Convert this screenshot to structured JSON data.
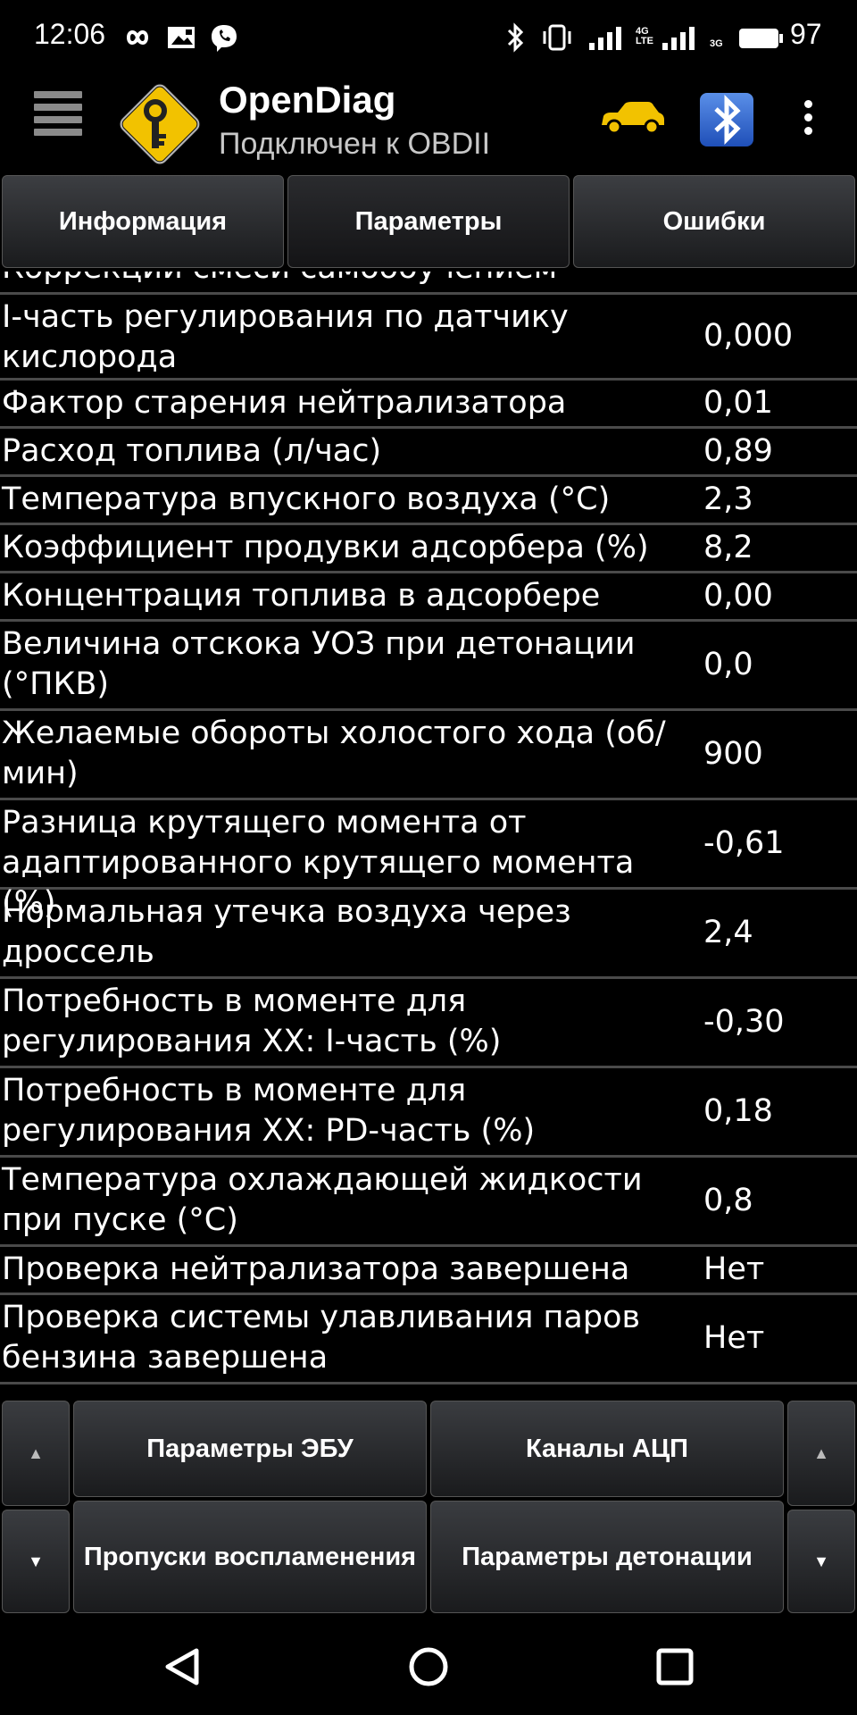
{
  "status_bar": {
    "time": "12:06",
    "net_4g_top": "4G",
    "net_4g_bottom": "LTE",
    "net_3g": "3G",
    "battery": "97"
  },
  "app_bar": {
    "title": "OpenDiag",
    "subtitle": "Подключен к OBDII"
  },
  "tabs": [
    {
      "label": "Информация"
    },
    {
      "label": "Параметры"
    },
    {
      "label": "Ошибки"
    }
  ],
  "params": {
    "partial_top": "Коррекции смеси самообучением",
    "rows": [
      {
        "name": "I-часть регулирования по датчику кислорода",
        "value": "0,000"
      },
      {
        "name": "Фактор старения нейтрализатора",
        "value": "0,01"
      },
      {
        "name": "Расход топлива (л/час)",
        "value": "0,89"
      },
      {
        "name": "Температура впускного воздуха (°С)",
        "value": "2,3"
      },
      {
        "name": "Коэффициент продувки адсорбера (%)",
        "value": "8,2"
      },
      {
        "name": "Концентрация топлива в адсорбере",
        "value": "0,00"
      },
      {
        "name": "Величина отскока УОЗ при детонации (°ПКВ)",
        "value": "0,0"
      },
      {
        "name": "Желаемые обороты холостого хода (об/мин)",
        "value": "900"
      },
      {
        "name": "Разница крутящего момента от адаптированного крутящего момента (%)",
        "value": "-0,61"
      },
      {
        "name": "Нормальная утечка воздуха через дроссель",
        "value": "2,4"
      },
      {
        "name": "Потребность в моменте для регулирования ХХ: I-часть (%)",
        "value": "-0,30"
      },
      {
        "name": "Потребность в моменте для регулирования ХХ: PD-часть (%)",
        "value": "0,18"
      },
      {
        "name": "Температура охлаждающей жидкости при пуске (°С)",
        "value": "0,8"
      },
      {
        "name": "Проверка нейтрализатора завершена",
        "value": "Нет"
      },
      {
        "name": "Проверка системы улавливания паров бензина завершена",
        "value": "Нет"
      }
    ]
  },
  "bottom_buttons": {
    "up_arrow": "▲",
    "down_arrow": "▼",
    "ecu_params": "Параметры ЭБУ",
    "adc_channels": "Каналы АЦП",
    "misfires": "Пропуски воспламенения",
    "knock_params": "Параметры детонации"
  }
}
